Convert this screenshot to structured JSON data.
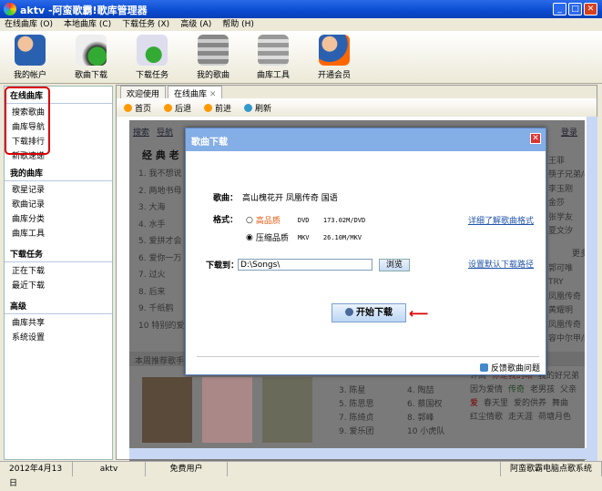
{
  "window": {
    "title": "aktv -阿蛮歌霸!歌库管理器",
    "min": "_",
    "max": "□",
    "close": "✕"
  },
  "menu": [
    "在线曲库 (O)",
    "本地曲库 (C)",
    "下载任务 (X)",
    "高级 (A)",
    "帮助 (H)"
  ],
  "toolbar": [
    {
      "label": "我的帐户",
      "icon": "user-info-icon"
    },
    {
      "label": "歌曲下载",
      "icon": "headphones-download-icon"
    },
    {
      "label": "下载任务",
      "icon": "notepad-download-icon"
    },
    {
      "label": "我的歌曲",
      "icon": "database-headphones-icon"
    },
    {
      "label": "曲库工具",
      "icon": "database-gear-icon"
    },
    {
      "label": "开通会员",
      "icon": "user-star-icon"
    }
  ],
  "sidebar": {
    "sections": [
      {
        "title": "在线曲库",
        "items": [
          "搜索歌曲",
          "曲库导航",
          "下载排行",
          "新歌速递"
        ]
      },
      {
        "title": "我的曲库",
        "items": [
          "歌星记录",
          "歌曲记录",
          "曲库分类",
          "曲库工具"
        ]
      },
      {
        "title": "下载任务",
        "items": [
          "正在下载",
          "最近下载"
        ]
      },
      {
        "title": "高级",
        "items": [
          "曲库共享",
          "系统设置"
        ]
      }
    ]
  },
  "tabs": [
    "欢迎使用",
    "在线曲库"
  ],
  "nav": [
    "首页",
    "后退",
    "前进",
    "刷新"
  ],
  "web": {
    "links": [
      "搜索",
      "导航"
    ],
    "login": "登录",
    "heading": "经 典 老",
    "classics": [
      "1. 我不想说",
      "2. 两地书母",
      "3. 大海",
      "4. 水手",
      "5. 爱拼才会",
      "6. 爱你一万",
      "7. 过火",
      "8. 后来",
      "9. 千纸鹤",
      "10 特别的爱"
    ],
    "right1": [
      "更多",
      "王菲",
      "筷子兄弟/小沈阳",
      "李玉刚",
      "金莎",
      "张学友",
      "夏文汐"
    ],
    "right2": [
      "更多",
      "郭可唯",
      "TRY",
      "凤凰传奇",
      "黄耀明",
      "凤凰传奇",
      "容中尔甲/阳"
    ],
    "recommend": "本周推荐歌手",
    "singers": [
      "3. 陈星",
      "4. 陶喆",
      "5. 陈思思",
      "6. 蔡国权",
      "7. 陈绮贞",
      "8. 郭峰",
      "9. 爱乐团",
      "10 小虎队"
    ],
    "tags": [
      "许嵩",
      "你是我的眼",
      "我的好兄弟",
      "因为爱情",
      "传奇",
      "老男孩",
      "父亲",
      "爱",
      "春天里",
      "爱的供养",
      "舞曲",
      "红尘情歌",
      "走天涯",
      "荷塘月色"
    ]
  },
  "dialog": {
    "title": "歌曲下载",
    "close": "✕",
    "song_label": "歌曲：",
    "song": "高山槐花开 凤凰传奇 国语",
    "format_label": "格式：",
    "formats": [
      {
        "name": "高品质",
        "type": "DVD",
        "size": "173.02M/DVD",
        "selected": false
      },
      {
        "name": "压缩品质",
        "type": "MKV",
        "size": "26.10M/MKV",
        "selected": true
      }
    ],
    "format_link": "详细了解歌曲格式",
    "dest_label": "下载到：",
    "dest": "D:\\Songs\\",
    "browse": "浏览",
    "dest_link": "设置默认下载路径",
    "start": "开始下载",
    "arrow": "⟵",
    "feedback": "反馈歌曲问题"
  },
  "status": {
    "date": "2012年4月13日",
    "user": "aktv",
    "type": "免费用户",
    "product": "阿蛮歌霸电脑点歌系统"
  }
}
